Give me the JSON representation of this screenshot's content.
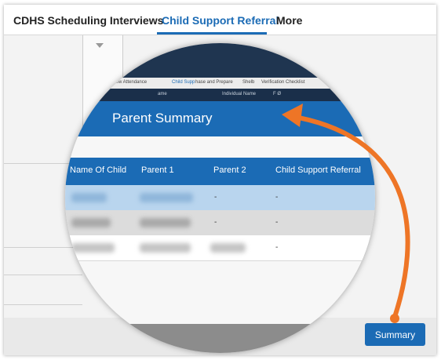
{
  "tabs": [
    {
      "label": "CDHS Scheduling Interviews",
      "active": false
    },
    {
      "label": "Child Support Referral",
      "active": true
    },
    {
      "label": "More",
      "active": false
    }
  ],
  "summary_button": "Summary",
  "zoom": {
    "nav_items": [
      "aling is view Attendance",
      "Child Supp",
      "hase and Prepare",
      "Shelb",
      "Verification Checklist"
    ],
    "strip_items": [
      "ame",
      "Individual Name",
      "F  Ø"
    ],
    "panel_title": "Parent Summary",
    "columns": [
      "Name Of Child",
      "Parent 1",
      "Parent 2",
      "Child Support Referral"
    ],
    "rows": [
      {
        "parent2": "-",
        "referral": "-"
      },
      {
        "parent2": "-",
        "referral": "-"
      },
      {
        "parent2": "",
        "referral": "-"
      }
    ]
  },
  "colors": {
    "accent": "#1b6bb5",
    "arrow": "#ee7526",
    "row_highlight": "#b9d5ee",
    "row_gray": "#dcdcdc"
  }
}
